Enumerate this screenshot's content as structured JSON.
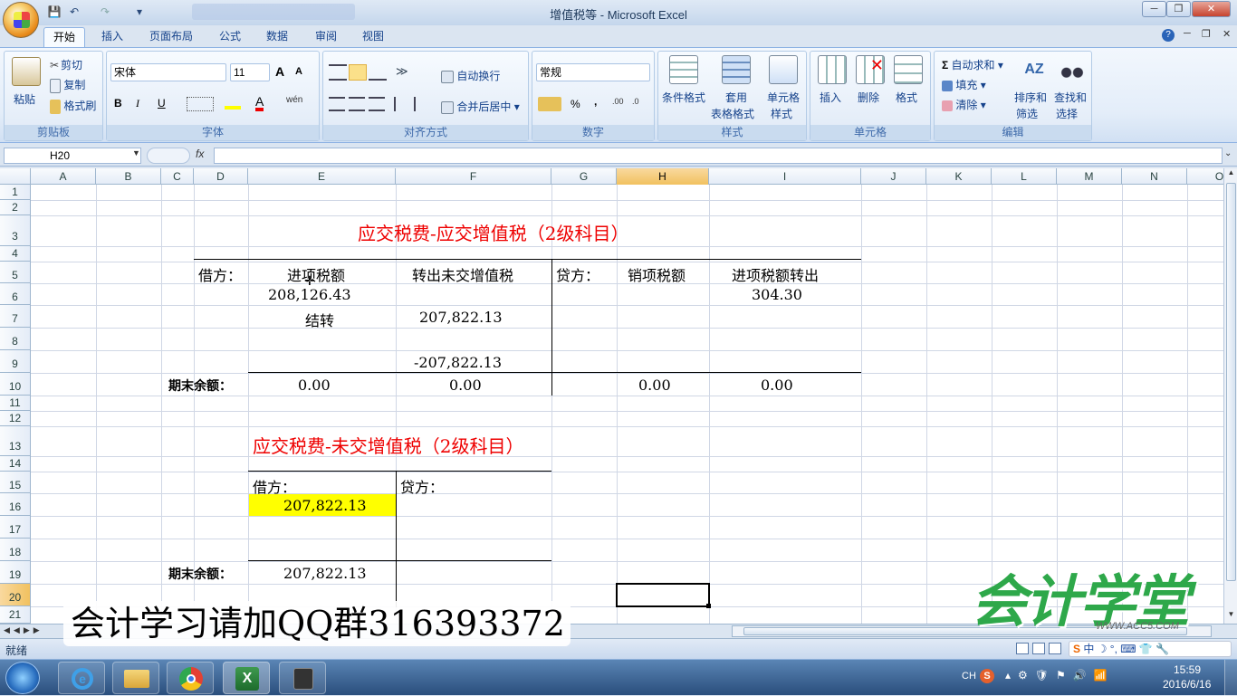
{
  "window": {
    "title": "增值税等 - Microsoft Excel"
  },
  "qat": {
    "save": "💾",
    "undo": "↶",
    "redo": "↷",
    "customize": "▾"
  },
  "tabs": [
    "开始",
    "插入",
    "页面布局",
    "公式",
    "数据",
    "审阅",
    "视图"
  ],
  "clipboard": {
    "paste": "粘贴",
    "cut": "剪切",
    "copy": "复制",
    "format_painter": "格式刷",
    "label": "剪贴板"
  },
  "font": {
    "name": "宋体",
    "size": "11",
    "bold": "B",
    "italic": "I",
    "underline": "U",
    "label": "字体",
    "grow": "A",
    "shrink": "A"
  },
  "alignment": {
    "wrap": "自动换行",
    "merge": "合并后居中",
    "label": "对齐方式"
  },
  "number": {
    "format": "常规",
    "percent": "%",
    "comma": ",",
    "label": "数字"
  },
  "styles": {
    "conditional": "条件格式",
    "table_line1": "套用",
    "table_line2": "表格格式",
    "cell_line1": "单元格",
    "cell_line2": "样式",
    "label": "样式"
  },
  "cells": {
    "insert": "插入",
    "delete": "删除",
    "format": "格式",
    "label": "单元格"
  },
  "editing": {
    "autosum": "自动求和",
    "fill": "填充",
    "clear": "清除",
    "sort_line1": "排序和",
    "sort_line2": "筛选",
    "find_line1": "查找和",
    "find_line2": "选择",
    "label": "编辑"
  },
  "formula_bar": {
    "name_box": "H20",
    "fx": "fx",
    "value": ""
  },
  "columns": [
    "A",
    "B",
    "C",
    "D",
    "E",
    "F",
    "G",
    "H",
    "I",
    "J",
    "K",
    "L",
    "M",
    "N",
    "O"
  ],
  "rows": [
    "1",
    "2",
    "3",
    "4",
    "5",
    "6",
    "7",
    "8",
    "9",
    "10",
    "11",
    "12",
    "13",
    "14",
    "15",
    "16",
    "17",
    "18",
    "19",
    "20",
    "21"
  ],
  "sheet": {
    "title1": "应交税费-应交增值税（2级科目）",
    "debit": "借方：",
    "input_tax": "进项税额",
    "transfer_out_unpaid": "转出未交增值税",
    "credit": "贷方：",
    "output_tax": "销项税额",
    "input_tax_transfer_out": "进项税额转出",
    "e6": "208,126.43",
    "i6": "304.30",
    "e7": "结转",
    "f7": "207,822.13",
    "f9": "-207,822.13",
    "ending_balance": "期末余额：",
    "e10": "0.00",
    "f10": "0.00",
    "h10": "0.00",
    "i10": "0.00",
    "title2": "应交税费-未交增值税（2级科目）",
    "debit2": "借方：",
    "credit2": "贷方：",
    "e16": "207,822.13",
    "ending_balance2": "期末余额：",
    "e19": "207,822.13"
  },
  "status": {
    "ready": "就绪"
  },
  "overlay": {
    "qq_text": "会计学习请加QQ群316393372",
    "logo_text": "会计学堂",
    "logo_url": "WWW.ACC5.COM"
  },
  "taskbar": {
    "lang": "CH",
    "time": "15:59",
    "date": "2016/6/16"
  },
  "colors": {
    "highlight": "#ffff00",
    "title_red": "#ee0000",
    "selected_header": "#f1c15f"
  }
}
